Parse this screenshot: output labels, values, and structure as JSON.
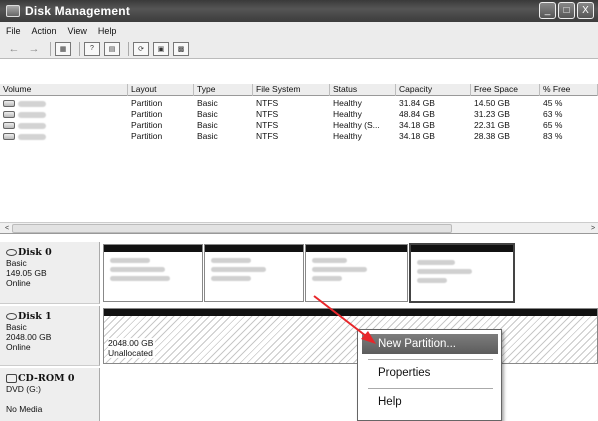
{
  "window": {
    "title": "Disk Management",
    "minimize": "_",
    "maximize": "□",
    "close": "X"
  },
  "menu": {
    "items": [
      "File",
      "Action",
      "View",
      "Help"
    ]
  },
  "toolbar": {
    "back": "←",
    "forward": "→"
  },
  "list": {
    "columns": [
      "Volume",
      "Layout",
      "Type",
      "File System",
      "Status",
      "Capacity",
      "Free Space",
      "% Free"
    ],
    "rows": [
      {
        "layout": "Partition",
        "type": "Basic",
        "fs": "NTFS",
        "status": "Healthy",
        "capacity": "31.84 GB",
        "free": "14.50 GB",
        "pct": "45 %"
      },
      {
        "layout": "Partition",
        "type": "Basic",
        "fs": "NTFS",
        "status": "Healthy",
        "capacity": "48.84 GB",
        "free": "31.23 GB",
        "pct": "63 %"
      },
      {
        "layout": "Partition",
        "type": "Basic",
        "fs": "NTFS",
        "status": "Healthy (S...",
        "capacity": "34.18 GB",
        "free": "22.31 GB",
        "pct": "65 %"
      },
      {
        "layout": "Partition",
        "type": "Basic",
        "fs": "NTFS",
        "status": "Healthy",
        "capacity": "34.18 GB",
        "free": "28.38 GB",
        "pct": "83 %"
      }
    ],
    "scroll_left": "<",
    "scroll_right": ">"
  },
  "disks": [
    {
      "name": "Disk 0",
      "type": "Basic",
      "size": "149.05 GB",
      "state": "Online"
    },
    {
      "name": "Disk 1",
      "type": "Basic",
      "size": "2048.00 GB",
      "state": "Online",
      "unallocated_size": "2048.00 GB",
      "unallocated_label": "Unallocated"
    },
    {
      "name": "CD-ROM 0",
      "type": "DVD (G:)",
      "state": "No Media"
    }
  ],
  "context_menu": {
    "items": [
      "New Partition...",
      "Properties",
      "Help"
    ]
  },
  "colors": {
    "title_bar": "#444444",
    "highlight": "#6a6a6a",
    "arrow": "#e8262a"
  }
}
